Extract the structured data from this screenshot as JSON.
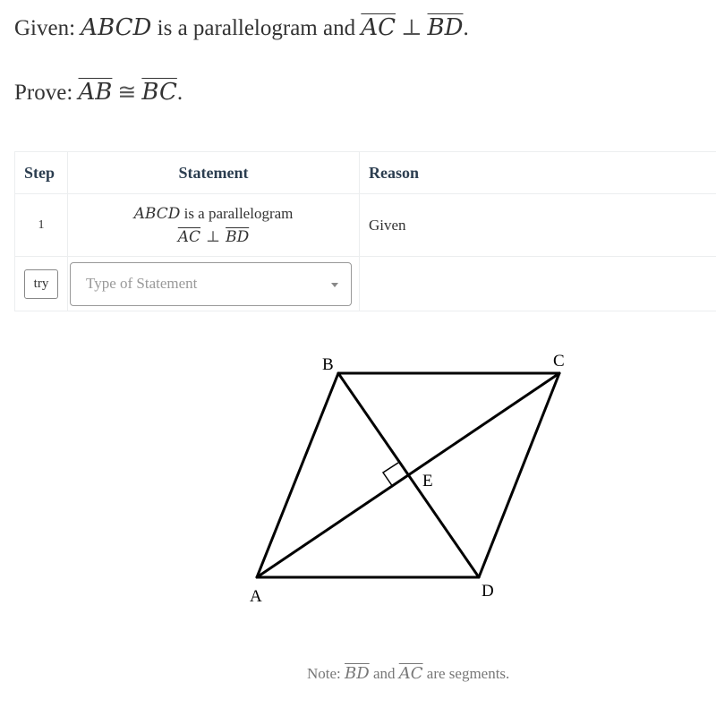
{
  "problem": {
    "given_label": "Given:",
    "given_math": "ABCD",
    "given_text": "is a parallelogram and",
    "given_seg1": "AC",
    "perp_symbol": "⊥",
    "given_seg2": "BD",
    "given_end": ".",
    "prove_label": "Prove:",
    "prove_seg1": "AB",
    "congruent_symbol": "≅",
    "prove_seg2": "BC",
    "prove_end": "."
  },
  "table": {
    "headers": {
      "step": "Step",
      "statement": "Statement",
      "reason": "Reason"
    },
    "rows": [
      {
        "step": "1",
        "statement_math": "ABCD",
        "statement_text": "is a parallelogram",
        "statement_seg1": "AC",
        "perp_symbol": "⊥",
        "statement_seg2": "BD",
        "reason": "Given"
      }
    ],
    "input_row": {
      "try_label": "try",
      "select_placeholder": "Type of Statement"
    }
  },
  "figure": {
    "labels": {
      "A": "A",
      "B": "B",
      "C": "C",
      "D": "D",
      "E": "E"
    },
    "segments": [
      "AB",
      "BC",
      "CD",
      "DA",
      "AC",
      "BD"
    ],
    "right_angle_at": "E"
  },
  "note": {
    "prefix": "Note:",
    "seg1": "BD",
    "middle": "and",
    "seg2": "AC",
    "suffix": "are segments."
  }
}
